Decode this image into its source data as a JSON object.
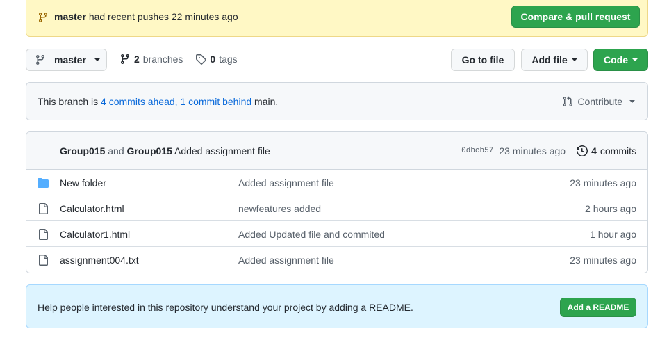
{
  "push_banner": {
    "branch": "master",
    "message": "had recent pushes 22 minutes ago",
    "compare_button": "Compare & pull request"
  },
  "branch_nav": {
    "current_branch": "master",
    "branches_count": "2",
    "branches_label": "branches",
    "tags_count": "0",
    "tags_label": "tags",
    "go_to_file": "Go to file",
    "add_file": "Add file",
    "code": "Code"
  },
  "compare": {
    "prefix": "This branch is",
    "ahead": "4 commits ahead,",
    "behind": "1 commit behind",
    "base": "main.",
    "contribute": "Contribute"
  },
  "latest_commit": {
    "author1": "Group015",
    "joiner": "and",
    "author2": "Group015",
    "message": "Added assignment file",
    "hash": "0dbcb57",
    "age": "23 minutes ago",
    "commits_count": "4",
    "commits_label": "commits"
  },
  "files": [
    {
      "name": "New folder",
      "type": "folder",
      "message": "Added assignment file",
      "age": "23 minutes ago"
    },
    {
      "name": "Calculator.html",
      "type": "file",
      "message": "newfeatures added",
      "age": "2 hours ago"
    },
    {
      "name": "Calculator1.html",
      "type": "file",
      "message": "Added Updated file and commited",
      "age": "1 hour ago"
    },
    {
      "name": "assignment004.txt",
      "type": "file",
      "message": "Added assignment file",
      "age": "23 minutes ago"
    }
  ],
  "readme": {
    "text": "Help people interested in this repository understand your project by adding a README.",
    "button": "Add a README"
  },
  "colors": {
    "primary_green": "#2da44e",
    "link_blue": "#0969da",
    "folder_blue": "#54aeff",
    "banner_yellow": "#fff8c5",
    "banner_blue": "#ddf4ff"
  }
}
